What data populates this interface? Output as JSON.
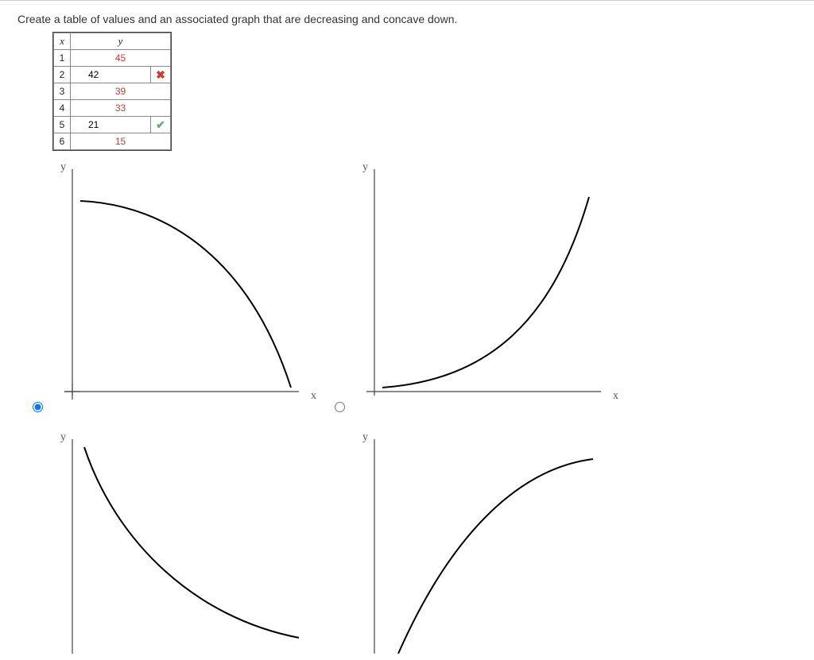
{
  "prompt": "Create a table of values and an associated graph that are decreasing and concave down.",
  "table": {
    "headers": {
      "x": "x",
      "y": "y"
    },
    "rows": [
      {
        "x": "1",
        "y_display": "45",
        "input": false
      },
      {
        "x": "2",
        "y_value": "42",
        "input": true,
        "mark": "wrong"
      },
      {
        "x": "3",
        "y_display": "39",
        "input": false
      },
      {
        "x": "4",
        "y_display": "33",
        "input": false
      },
      {
        "x": "5",
        "y_value": "21",
        "input": true,
        "mark": "correct"
      },
      {
        "x": "6",
        "y_display": "15",
        "input": false
      }
    ]
  },
  "marks": {
    "wrong_glyph": "✖",
    "correct_glyph": "✔"
  },
  "axes": {
    "x": "x",
    "y": "y"
  },
  "graphs": [
    {
      "id": "g1",
      "selected": true,
      "shape": "dec-concave-down"
    },
    {
      "id": "g2",
      "selected": false,
      "shape": "inc-concave-up"
    },
    {
      "id": "g3",
      "selected": false,
      "shape": "dec-concave-up"
    },
    {
      "id": "g4",
      "selected": false,
      "shape": "inc-concave-down"
    }
  ]
}
